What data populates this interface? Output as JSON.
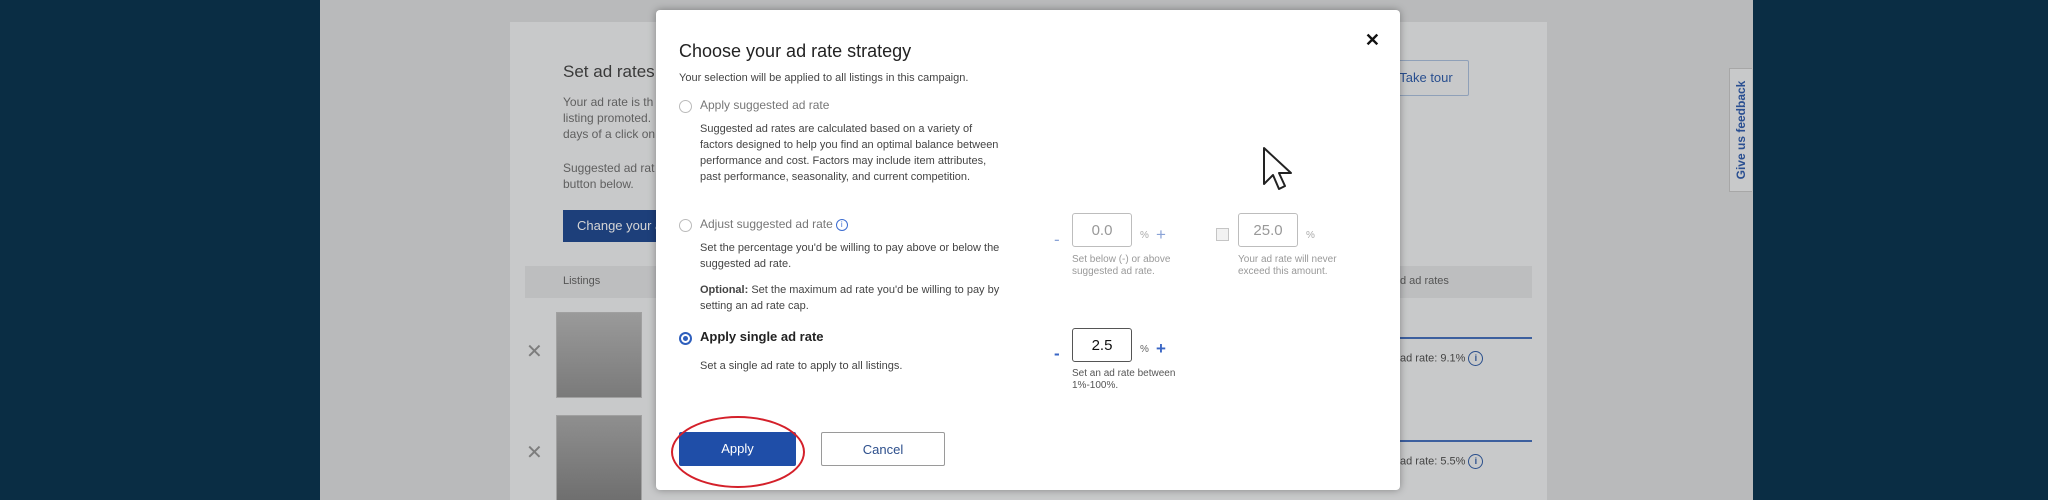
{
  "background": {
    "set_ad_rates_title": "Set ad rates",
    "intro_lines": [
      "Your ad rate is th",
      "listing promoted.",
      "days of a click on"
    ],
    "suggested_lines": [
      "Suggested ad rat",
      "button below."
    ],
    "change_button": "Change your a",
    "take_tour": "Take tour",
    "listings_header": "Listings",
    "ad_rates_header": "d ad rates",
    "rows": [
      {
        "rate": "ad rate: 9.1%"
      },
      {
        "rate": "ad rate: 5.5%"
      }
    ],
    "feedback": "Give us feedback"
  },
  "modal": {
    "title": "Choose your ad rate strategy",
    "subtitle": "Your selection will be applied to all listings in this campaign.",
    "close_glyph": "✕",
    "option1": {
      "label": "Apply suggested ad rate",
      "desc": "Suggested ad rates are calculated based on a variety of factors designed to help you find an optimal balance between performance and cost. Factors may include item attributes, past performance, seasonality, and current competition."
    },
    "option2": {
      "label": "Adjust suggested ad rate",
      "desc": "Set the percentage you'd be willing to pay above or below the suggested ad rate.",
      "optional_label": "Optional:",
      "optional_desc": " Set the maximum ad rate you'd be willing to pay by setting an ad rate cap.",
      "adjust_value": "0.0",
      "adjust_hint_1": "Set below (-) or above",
      "adjust_hint_2": "suggested ad rate.",
      "cap_value": "25.0",
      "cap_hint_1": "Your ad rate will never",
      "cap_hint_2": "exceed this amount."
    },
    "option3": {
      "label": "Apply single ad rate",
      "desc": "Set a single ad rate to apply to all listings.",
      "value": "2.5",
      "hint_1": "Set an ad rate between",
      "hint_2": "1%-100%."
    },
    "minus": "-",
    "plus": "+",
    "percent": "%",
    "apply": "Apply",
    "cancel": "Cancel",
    "selected_option": 3
  }
}
